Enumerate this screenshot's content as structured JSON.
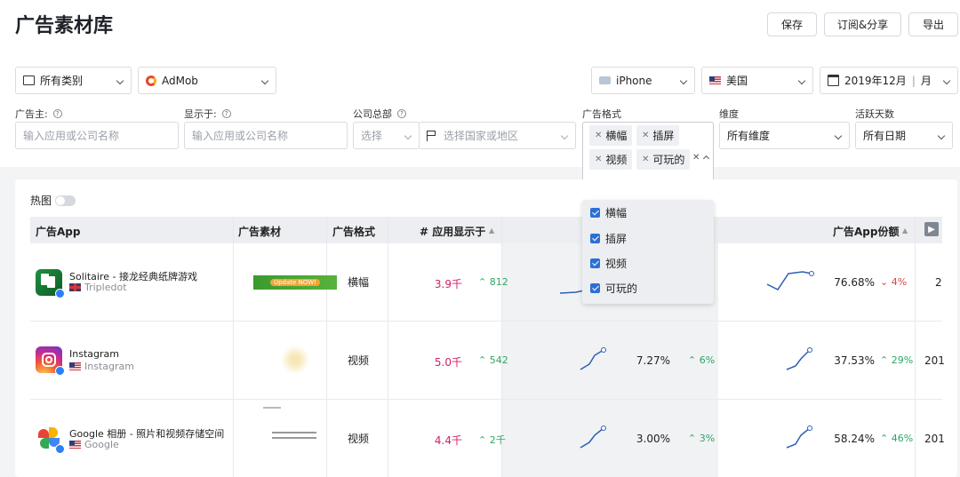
{
  "page": {
    "title": "广告素材库"
  },
  "toolbar": {
    "save": "保存",
    "subscribe_share": "订阅&分享",
    "export": "导出"
  },
  "filters": {
    "category": "所有类别",
    "network": "AdMob",
    "device": "iPhone",
    "country": "美国",
    "date": "2019年12月",
    "date_unit": "月",
    "advertiser_label": "广告主:",
    "advertiser_placeholder": "输入应用或公司名称",
    "shown_on_label": "显示于:",
    "shown_on_placeholder": "输入应用或公司名称",
    "hq_label": "公司总部",
    "hq_select": "选择",
    "hq_country_placeholder": "选择国家或地区",
    "ad_format_label": "广告格式",
    "ad_format_tags": [
      "横幅",
      "插屏",
      "视频",
      "可玩的"
    ],
    "dimension_label": "维度",
    "dimension_value": "所有维度",
    "active_days_label": "活跃天数",
    "active_days_value": "所有日期"
  },
  "dropdown": {
    "options": [
      {
        "label": "横幅",
        "checked": true
      },
      {
        "label": "插屏",
        "checked": true
      },
      {
        "label": "视频",
        "checked": true
      },
      {
        "label": "可玩的",
        "checked": true
      }
    ]
  },
  "table": {
    "heatmap_label": "热图",
    "headers": {
      "app": "广告App",
      "creative": "广告素材",
      "format": "广告格式",
      "apps_shown": "# 应用显示于",
      "share": "广告App份额"
    },
    "rows": [
      {
        "app": "Solitaire - 接龙经典纸牌游戏",
        "publisher": "Tripledot",
        "flag": "gb",
        "creative_text": "Update NOW!",
        "format": "横幅",
        "count": "3.9千",
        "count_change": "812",
        "mid_pct": "",
        "mid_change": "",
        "share": "76.68%",
        "share_change": "4%",
        "share_dir": "down",
        "last": "2"
      },
      {
        "app": "Instagram",
        "publisher": "Instagram",
        "flag": "us",
        "creative_text": "",
        "format": "视频",
        "count": "5.0千",
        "count_change": "542",
        "mid_pct": "7.27%",
        "mid_change": "6%",
        "share": "37.53%",
        "share_change": "29%",
        "share_dir": "up",
        "last": "201"
      },
      {
        "app": "Google 相册 - 照片和视频存储空间",
        "publisher": "Google",
        "flag": "us",
        "creative_text": "",
        "format": "视频",
        "count": "4.4千",
        "count_change": "2千",
        "mid_pct": "3.00%",
        "mid_change": "3%",
        "share": "58.24%",
        "share_change": "46%",
        "share_dir": "up",
        "last": "201"
      }
    ]
  }
}
